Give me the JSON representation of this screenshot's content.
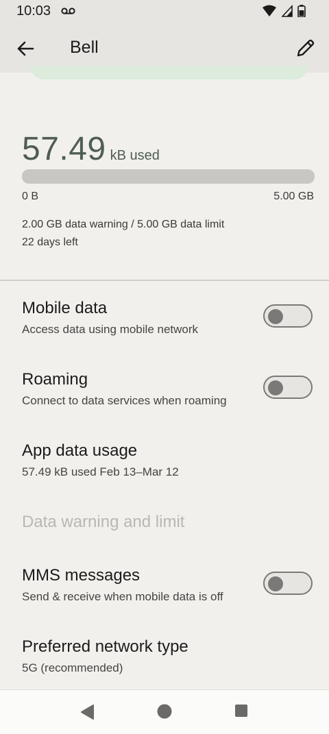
{
  "status_bar": {
    "time": "10:03",
    "icons": [
      "voicemail-icon",
      "wifi-icon",
      "signal-icon",
      "battery-icon"
    ]
  },
  "app_bar": {
    "title": "Bell",
    "back_icon": "arrow-back-icon",
    "edit_icon": "pencil-icon"
  },
  "usage": {
    "amount": "57.49",
    "unit": "kB used",
    "bar_min": "0 B",
    "bar_max": "5.00 GB",
    "bar_fill_fraction": 0.0,
    "warning_limit": "2.00 GB data warning / 5.00 GB data limit",
    "days_left": "22 days left"
  },
  "settings": [
    {
      "title": "Mobile data",
      "subtitle": "Access data using mobile network",
      "toggle": false
    },
    {
      "title": "Roaming",
      "subtitle": "Connect to data services when roaming",
      "toggle": false
    },
    {
      "title": "App data usage",
      "subtitle": "57.49 kB used Feb 13–Mar 12"
    },
    {
      "title": "Data warning and limit",
      "disabled": true
    },
    {
      "title": "MMS messages",
      "subtitle": "Send & receive when mobile data is off",
      "toggle": false
    },
    {
      "title": "Preferred network type",
      "subtitle": "5G (recommended)"
    }
  ],
  "colors": {
    "accent": "#4f5d54",
    "background": "#f1f0ed",
    "header": "#e6e5e2",
    "disabled_text": "#b8b7b4"
  }
}
